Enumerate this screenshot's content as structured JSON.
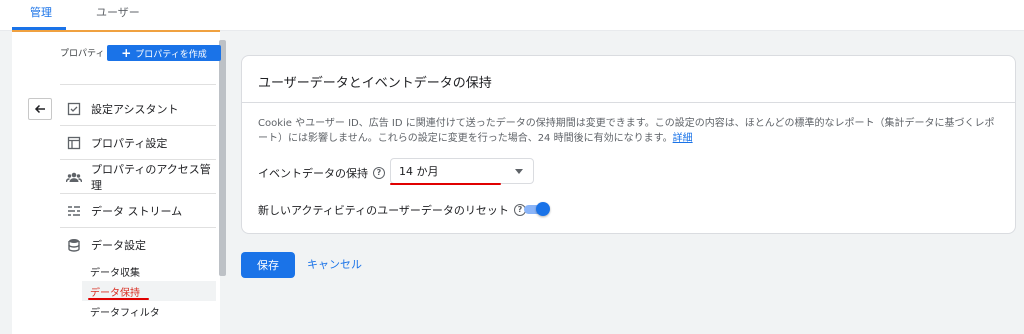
{
  "tabs": [
    {
      "label": "管理"
    },
    {
      "label": "ユーザー"
    }
  ],
  "sidebar": {
    "property_label": "プロパティ",
    "create_property": "プロパティを作成",
    "items": [
      {
        "label": "設定アシスタント",
        "icon": "checklist-icon"
      },
      {
        "label": "プロパティ設定",
        "icon": "layout-icon"
      },
      {
        "label": "プロパティのアクセス管理",
        "icon": "people-icon"
      },
      {
        "label": "データ ストリーム",
        "icon": "streams-icon"
      },
      {
        "label": "データ設定",
        "icon": "database-icon"
      }
    ],
    "subitems": [
      {
        "label": "データ収集"
      },
      {
        "label": "データ保持"
      },
      {
        "label": "データフィルタ"
      }
    ]
  },
  "card": {
    "title": "ユーザーデータとイベントデータの保持",
    "description": "Cookie やユーザー ID、広告 ID に関連付けて送ったデータの保持期間は変更できます。この設定の内容は、ほとんどの標準的なレポート（集計データに基づくレポート）には影響しません。これらの設定に変更を行った場合、24 時間後に有効になります。",
    "details_link": "詳細",
    "event_retention_label": "イベントデータの保持",
    "event_retention_value": "14 か月",
    "reset_label": "新しいアクティビティのユーザーデータのリセット",
    "reset_enabled": true
  },
  "actions": {
    "save": "保存",
    "cancel": "キャンセル"
  },
  "colors": {
    "accent": "#1a73e8",
    "annotation": "#e00000",
    "active_subitem": "#d93025"
  }
}
